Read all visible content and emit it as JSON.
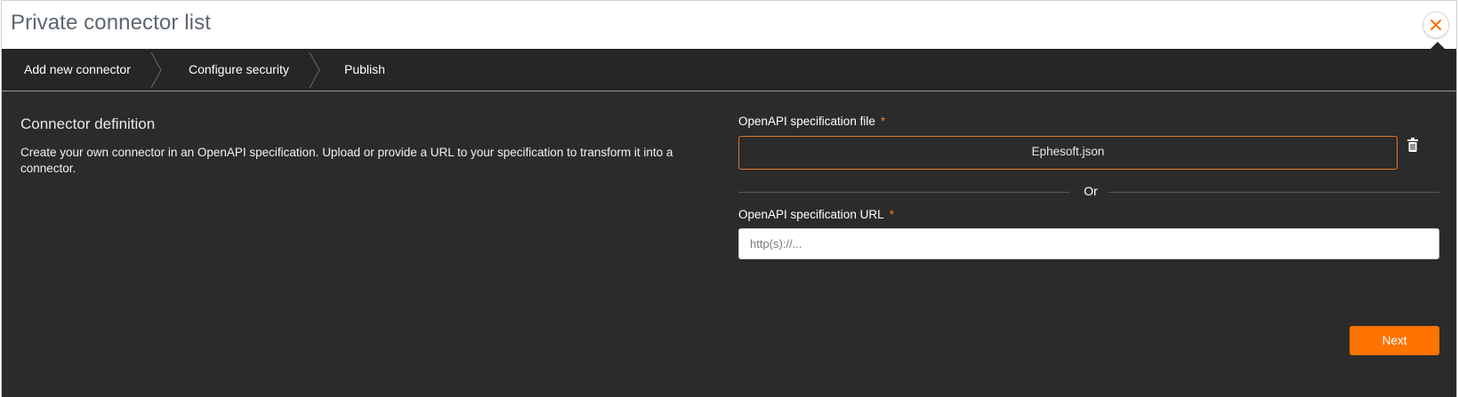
{
  "dialog": {
    "title": "Private connector list",
    "close_icon": "close-icon"
  },
  "steps": [
    {
      "label": "Add new connector"
    },
    {
      "label": "Configure security"
    },
    {
      "label": "Publish"
    }
  ],
  "definition": {
    "title": "Connector definition",
    "description": "Create your own connector in an OpenAPI specification. Upload or provide a URL to your specification to transform it into a connector."
  },
  "file_field": {
    "label": "OpenAPI specification file",
    "required_mark": "*",
    "value": "Ephesoft.json",
    "delete_icon": "trash-icon"
  },
  "divider": {
    "text": "Or"
  },
  "url_field": {
    "label": "OpenAPI specification URL",
    "required_mark": "*",
    "value": "",
    "placeholder": "http(s)://..."
  },
  "actions": {
    "next_label": "Next"
  },
  "colors": {
    "accent": "#ff7300",
    "panel_bg": "#2b2b2b",
    "stepper_bg": "#262626",
    "file_border": "#e0782d"
  }
}
